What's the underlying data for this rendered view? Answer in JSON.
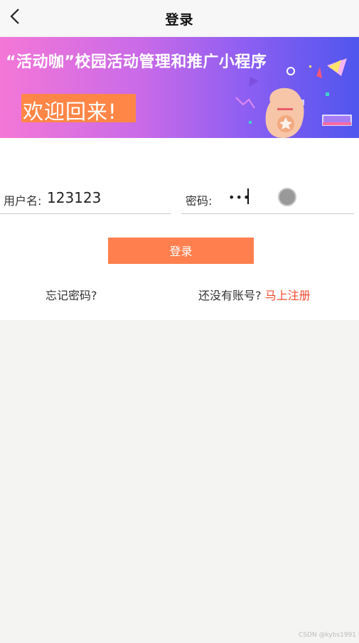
{
  "nav": {
    "title": "登录",
    "back_icon": "chevron-left-icon"
  },
  "banner": {
    "headline": "“活动咖”校园活动管理和推广小程序",
    "welcome": "欢迎回来!"
  },
  "form": {
    "username_label": "用户名:",
    "username_value": "123123",
    "password_label": "密码:",
    "password_value": "•••",
    "toggle_icon": "circle-toggle-icon",
    "login_button": "登录",
    "forgot_password": "忘记密码?",
    "no_account_text": "还没有账号?",
    "register_link": "马上注册"
  },
  "watermark": "CSDN @kybs1991",
  "colors": {
    "accent": "#ff7f4e",
    "register_link": "#f14a2e",
    "banner_gradient": [
      "#f477d7",
      "#c86ae8",
      "#8a5ef2",
      "#4f56ee"
    ],
    "background": "#f4f4f3"
  }
}
